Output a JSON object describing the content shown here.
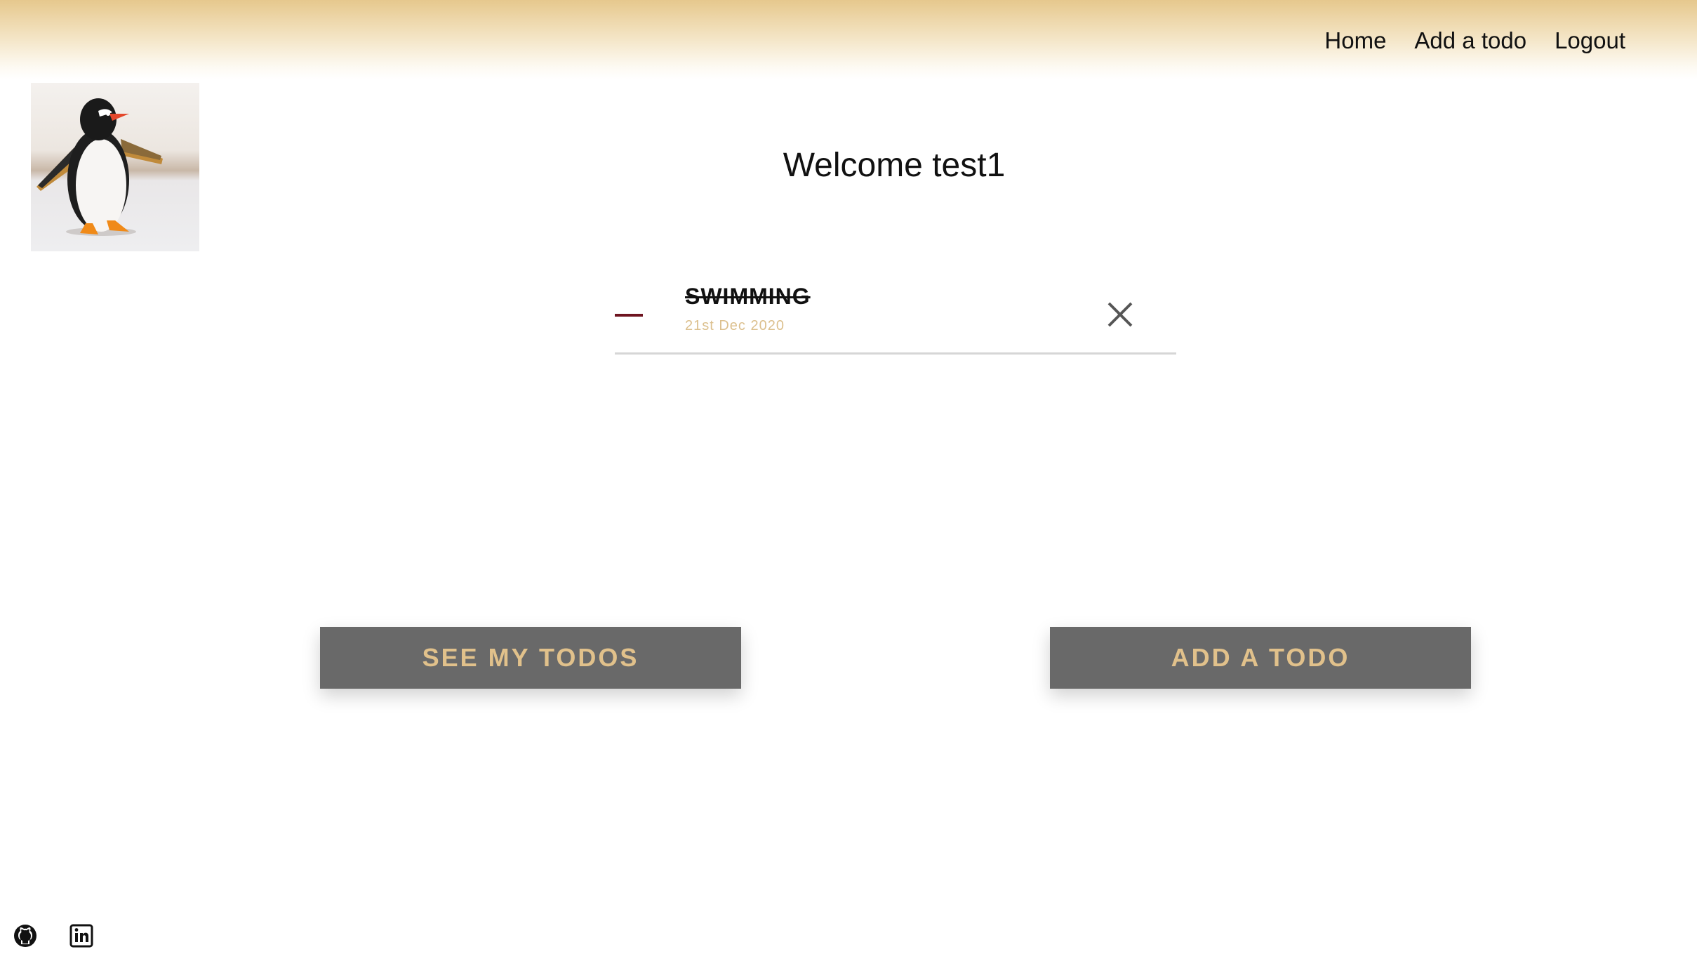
{
  "nav": {
    "items": [
      {
        "label": "Home"
      },
      {
        "label": "Add a todo"
      },
      {
        "label": "Logout"
      }
    ]
  },
  "avatar": {
    "icon": "penguin-image"
  },
  "welcome": {
    "text": "Welcome test1"
  },
  "todos": [
    {
      "title": "SWIMMING",
      "date": "21st Dec 2020",
      "completed": true
    }
  ],
  "actions": {
    "see_todos_label": "SEE MY TODOS",
    "add_todo_label": "ADD A TODO"
  },
  "footer": {
    "icons": [
      "github-icon",
      "linkedin-icon"
    ]
  },
  "colors": {
    "header_gold": "#e6c88d",
    "button_bg": "#696969",
    "button_text": "#e1c18b",
    "date_text": "#dcc08e",
    "dash": "#6e1420"
  }
}
